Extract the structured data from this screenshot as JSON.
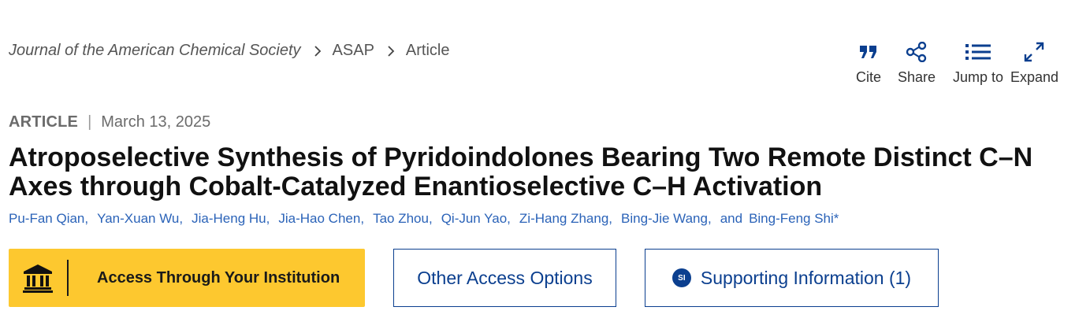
{
  "breadcrumb": {
    "journal": "Journal of the American Chemical Society",
    "section": "ASAP",
    "page": "Article"
  },
  "toolbar": {
    "cite": "Cite",
    "share": "Share",
    "jump_to": "Jump to",
    "expand": "Expand"
  },
  "meta": {
    "type": "ARTICLE",
    "separator": "|",
    "date": "March 13, 2025"
  },
  "title": "Atroposelective Synthesis of Pyridoindolones Bearing Two Remote Distinct C–N Axes through Cobalt-Catalyzed Enantioselective C–H Activation",
  "authors": [
    "Pu-Fan Qian",
    "Yan-Xuan Wu",
    "Jia-Heng Hu",
    "Jia-Hao Chen",
    "Tao Zhou",
    "Qi-Jun Yao",
    "Zi-Hang Zhang",
    "Bing-Jie Wang",
    "Bing-Feng Shi*"
  ],
  "authors_conjunction": "and",
  "authors_separator": ",",
  "access": {
    "institution_label": "Access Through Your Institution",
    "other_label": "Other Access Options",
    "si_badge": "SI",
    "si_label": "Supporting Information (1)"
  },
  "colors": {
    "accent": "#0b3f8f",
    "author_link": "#2b63b8",
    "institution_button": "#fdc82f"
  },
  "icons": [
    "chevron-right-icon",
    "quote-icon",
    "share-icon",
    "list-icon",
    "expand-icon",
    "institution-icon"
  ]
}
